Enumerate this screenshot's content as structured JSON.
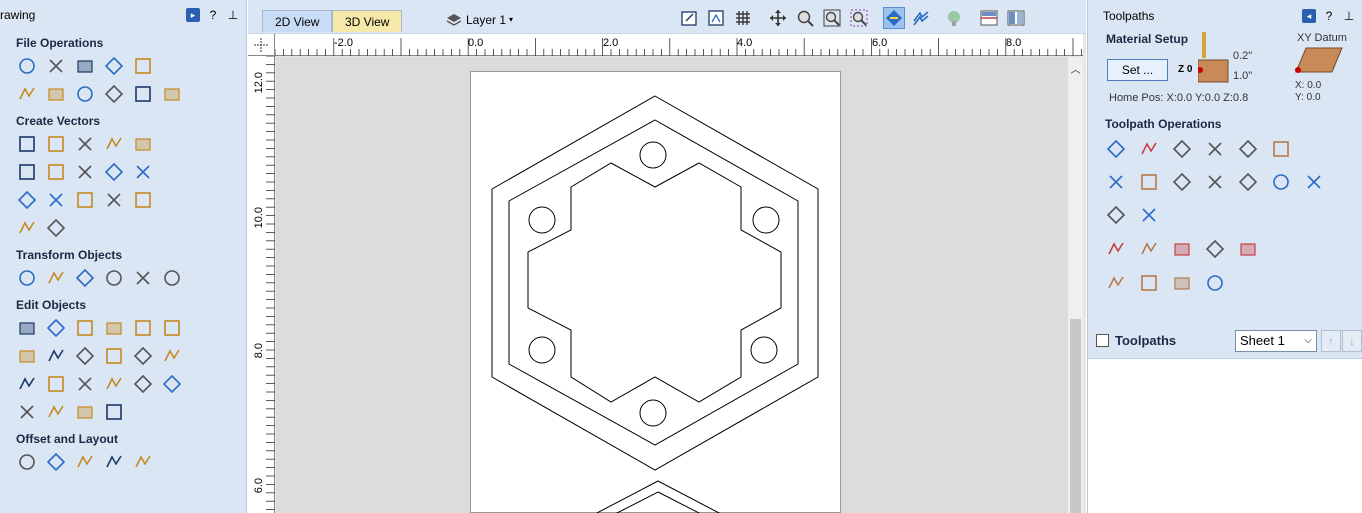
{
  "left_panel": {
    "title": "rawing",
    "title_buttons": [
      "pin-icon",
      "help-icon",
      "close-icon"
    ],
    "sections": [
      {
        "title": "File Operations",
        "rows": [
          [
            "new-file",
            "open-file",
            "save-file",
            "open-folder",
            "import-folder"
          ],
          [
            "select-all-box",
            "cut",
            "copy",
            "paste",
            "undo",
            "redo"
          ]
        ]
      },
      {
        "title": "Create Vectors",
        "rows": [
          [
            "circle",
            "ellipse",
            "rectangle",
            "polygon",
            "star"
          ],
          [
            "polyline",
            "arc",
            "curve",
            "text-on-curve",
            "wave"
          ],
          [
            "text",
            "text-frame",
            "text-cursor",
            "text-auto",
            "text-abc"
          ],
          [
            "dimension-arrow",
            "dimension-measure"
          ]
        ]
      },
      {
        "title": "Transform Objects",
        "rows": [
          [
            "move",
            "scale",
            "align",
            "mirror",
            "distort",
            "nudge"
          ]
        ]
      },
      {
        "title": "Edit Objects",
        "rows": [
          [
            "select",
            "node-edit",
            "node-add",
            "trim-bitmap",
            "delete-selection",
            "smooth"
          ],
          [
            "weld",
            "subtract",
            "intersect",
            "trim",
            "scissors",
            "fillet"
          ],
          [
            "dogbone",
            "bisect",
            "curve-fit",
            "join",
            "draw-edit",
            "scale-dim"
          ],
          [
            "closed-check",
            "curve-bracket",
            "curve-right",
            "zigzag"
          ]
        ]
      },
      {
        "title": "Offset and Layout",
        "rows": [
          [
            "offset",
            "grid-layout",
            "nesting",
            "step-repeat",
            "array-layout"
          ]
        ]
      }
    ]
  },
  "view": {
    "tabs": [
      {
        "label": "2D View",
        "active": true
      },
      {
        "label": "3D View",
        "active": false
      }
    ],
    "layer_label": "Layer 1",
    "ruler_top_labels": [
      "-2.0",
      "0.0",
      "2.0",
      "4.0",
      "6.0",
      "8.0"
    ],
    "ruler_left_labels": [
      "12.0",
      "10.0",
      "8.0",
      "6.0"
    ],
    "toolbar_icons": [
      "select-box-icon",
      "zoom-fit-icon",
      "grid-icon",
      "pan-icon",
      "zoom-icon",
      "zoom-extents-icon",
      "zoom-selected-icon",
      "snap-icon",
      "snap-off-icon",
      "shaded-icon",
      "view-split-icon",
      "view-tile-icon"
    ]
  },
  "right_panel": {
    "title": "Toolpaths",
    "title_buttons": [
      "pin-icon",
      "help-icon",
      "close-icon"
    ],
    "material_setup": {
      "heading": "Material Setup",
      "set_button": "Set ...",
      "z_label": "Z 0",
      "depth_top": "0.2\"",
      "depth_bottom": "1.0\"",
      "home_pos": "Home Pos:  X:0.0 Y:0.0 Z:0.8",
      "xy_datum": "XY Datum",
      "x": "X: 0.0",
      "y": "Y: 0.0"
    },
    "toolpath_ops": {
      "heading": "Toolpath Operations",
      "rows": [
        [
          "profile",
          "pocket",
          "drill",
          "vcarve-inlay",
          "texture-text",
          "engrave"
        ],
        [
          "fluting",
          "molding",
          "fluted-pocket",
          "wave-texture",
          "inlay",
          "prism",
          "roughing"
        ],
        [
          "finish-3d",
          "sphere"
        ],
        [
          "preview-tools",
          "edit-path",
          "toolpath-template",
          "delete-toolpath",
          "calculator"
        ],
        [
          "tool-database",
          "time-estimate",
          "merge",
          "save-toolpath"
        ]
      ]
    },
    "toolpaths": {
      "label": "Toolpaths",
      "sheet": "Sheet 1"
    }
  }
}
